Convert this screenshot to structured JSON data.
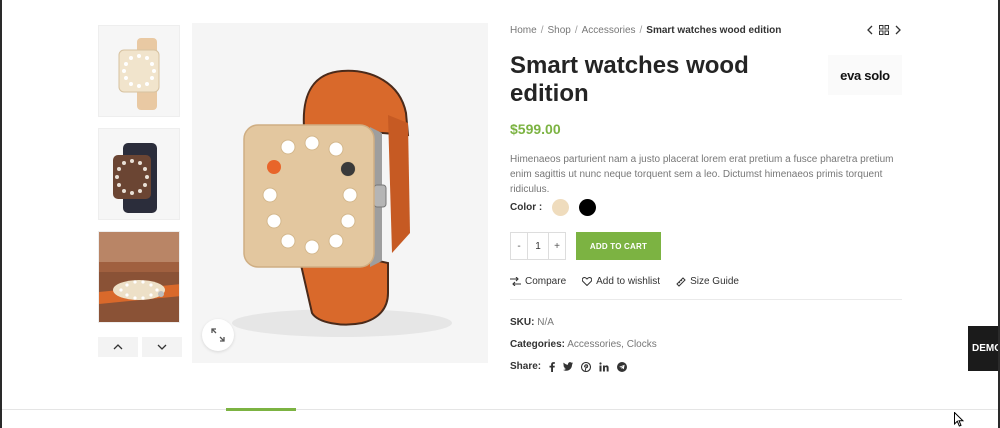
{
  "breadcrumb": {
    "items": [
      "Home",
      "Shop",
      "Accessories"
    ],
    "current": "Smart watches wood edition",
    "separator": "/"
  },
  "product": {
    "title": "Smart watches wood edition",
    "brand": "eva solo",
    "price": "$599.00",
    "description": "Himenaeos parturient nam a justo placerat lorem erat pretium a fusce pharetra pretium enim sagittis ut nunc neque torquent sem a leo. Dictumst himenaeos primis torquent ridiculus."
  },
  "variations": {
    "color_label": "Color :",
    "swatches": [
      {
        "name": "beige",
        "color": "#efdcbd"
      },
      {
        "name": "black",
        "color": "#000000"
      }
    ]
  },
  "cart": {
    "minus": "-",
    "quantity": "1",
    "plus": "+",
    "add_to_cart": "ADD TO CART"
  },
  "actions": {
    "compare": "Compare",
    "wishlist": "Add to wishlist",
    "size_guide": "Size Guide"
  },
  "meta": {
    "sku_label": "SKU:",
    "sku_value": "N/A",
    "categories_label": "Categories:",
    "categories": [
      "Accessories",
      "Clocks"
    ],
    "categories_sep": ",",
    "share_label": "Share:"
  },
  "share_icons": [
    "facebook-icon",
    "twitter-icon",
    "pinterest-icon",
    "linkedin-icon",
    "telegram-icon"
  ],
  "demo_tab": "DEMO",
  "colors": {
    "accent": "#7cb342",
    "strap_orange": "#d9692b",
    "wood": "#e3c79f"
  }
}
